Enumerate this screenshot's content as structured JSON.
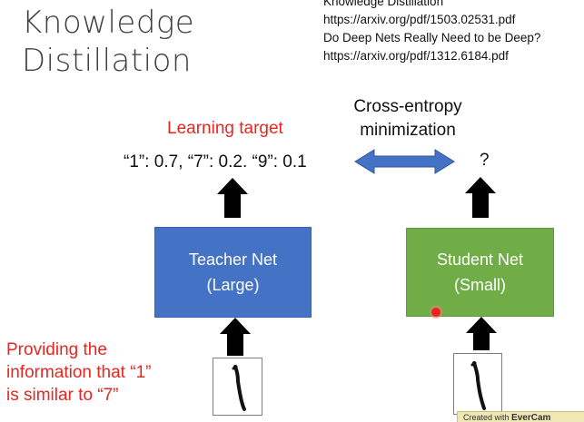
{
  "title": {
    "line1": "Knowledge",
    "line2": "Distillation"
  },
  "references": {
    "line1": "Knowledge Distillation",
    "line2": "https://arxiv.org/pdf/1503.02531.pdf",
    "line3": "Do Deep Nets Really Need to be Deep?",
    "line4": "https://arxiv.org/pdf/1312.6184.pdf"
  },
  "learning_target": "Learning target",
  "cross_entropy": {
    "line1": "Cross-entropy",
    "line2": "minimization"
  },
  "target_values": "“1”: 0.7, “7”: 0.2. “9”: 0.1",
  "student_output": "?",
  "teacher_net": {
    "line1": "Teacher Net",
    "line2": "(Large)"
  },
  "student_net": {
    "line1": "Student Net",
    "line2": "(Small)"
  },
  "providing_note": {
    "line1": "Providing the",
    "line2": "information that “1”",
    "line3": "is similar to “7”"
  },
  "watermark": {
    "prefix": "Created with",
    "brand": "EverCam"
  },
  "colors": {
    "teacher_fill": "#4472c4",
    "student_fill": "#70ad47",
    "highlight_text": "#e8261f",
    "double_arrow": "#4472c4",
    "arrow": "#000000"
  }
}
